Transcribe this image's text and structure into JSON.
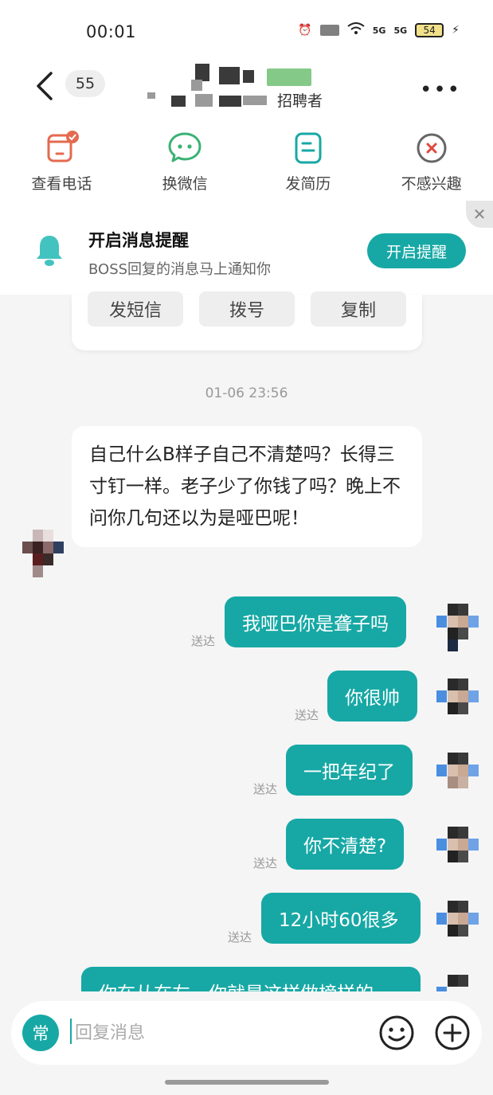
{
  "status": {
    "time": "00:01",
    "net1": "5G",
    "net2": "5G",
    "battery": "54"
  },
  "header": {
    "unread": "55",
    "role": "招聘者",
    "more": "•••"
  },
  "actions": [
    {
      "label": "查看电话",
      "icon": "phone-card-icon"
    },
    {
      "label": "换微信",
      "icon": "wechat-icon"
    },
    {
      "label": "发简历",
      "icon": "resume-icon"
    },
    {
      "label": "不感兴趣",
      "icon": "not-interested-icon"
    }
  ],
  "notify": {
    "title": "开启消息提醒",
    "desc": "BOSS回复的消息马上通知你",
    "button": "开启提醒",
    "close": "✕"
  },
  "card": {
    "sms": "发短信",
    "dial": "拨号",
    "copy": "复制"
  },
  "timestamp": "01-06 23:56",
  "incoming": {
    "text": "自己什么B样子自己不清楚吗？长得三寸钉一样。老子少了你钱了吗？晚上不问你几句还以为是哑巴呢！"
  },
  "outgoing": [
    {
      "text": "我哑巴你是聋子吗",
      "status": "送达"
    },
    {
      "text": "你很帅",
      "status": "送达"
    },
    {
      "text": "一把年纪了",
      "status": "送达"
    },
    {
      "text": "你不清楚?",
      "status": "送达"
    },
    {
      "text": "12小时60很多",
      "status": "送达"
    },
    {
      "text": "你在从在左，你就是这样做榜样的",
      "status": ""
    }
  ],
  "input": {
    "quick": "常",
    "placeholder": "回复消息"
  },
  "colors": {
    "accent": "#17a8a5",
    "background": "#f5f5f5"
  }
}
